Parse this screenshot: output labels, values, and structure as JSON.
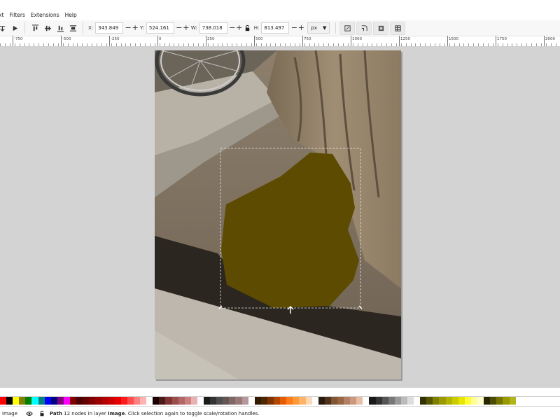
{
  "menubar": {
    "items": [
      "xt",
      "Filters",
      "Extensions",
      "Help"
    ]
  },
  "toolbar": {
    "x_label": "X:",
    "x_value": "343.849",
    "y_label": "Y:",
    "y_value": "524.161",
    "w_label": "W:",
    "w_value": "738.018",
    "h_label": "H:",
    "h_value": "813.497",
    "unit": "px",
    "minus": "−",
    "plus": "+"
  },
  "ruler": {
    "labels": [
      "-750",
      "-500",
      "-250",
      "0",
      "250",
      "500",
      "750",
      "1000",
      "1250",
      "1500",
      "1750",
      "2000"
    ]
  },
  "palette": {
    "colors": [
      "#ff0000",
      "#000000",
      "#ffff00",
      "#808000",
      "#008000",
      "#00ffff",
      "#008080",
      "#0000ff",
      "#000080",
      "#800080",
      "#ff00ff",
      "#800000",
      "#4d0000",
      "#660000",
      "#800000",
      "#990000",
      "#b30000",
      "#cc0000",
      "#e60000",
      "#ff1a1a",
      "#ff4d4d",
      "#ff8080",
      "#ffb3b3",
      "#ffffff",
      "#1a0000",
      "#4d1a1a",
      "#803333",
      "#994d4d",
      "#b36666",
      "#cc8080",
      "#e6b3b3",
      "#ffffff",
      "#1a1a1a",
      "#333333",
      "#4d4d4d",
      "#665555",
      "#806666",
      "#997777",
      "#b39999",
      "#ffffff",
      "#331a00",
      "#4d2600",
      "#803300",
      "#b34700",
      "#e65c00",
      "#ff7a1a",
      "#ff9933",
      "#ffb366",
      "#ffd9b3",
      "#ffffff",
      "#2b1a0d",
      "#4d3319",
      "#805533",
      "#996644",
      "#b38066",
      "#cc9980",
      "#e6bfa6",
      "#ffffff",
      "#1a1a1a",
      "#333333",
      "#555555",
      "#777777",
      "#999999",
      "#bbbbbb",
      "#dddddd",
      "#ffffff",
      "#333300",
      "#555500",
      "#808000",
      "#999900",
      "#b3b300",
      "#cccc00",
      "#e6e600",
      "#ffff33",
      "#ffff99",
      "#ffffcc",
      "#262600",
      "#4d4d00",
      "#737300",
      "#999900",
      "#b3b31a"
    ]
  },
  "status": {
    "layer_name": "Image",
    "object_type": "Path",
    "message": " 12 nodes in layer ",
    "layer_bold": "Image",
    "hint": ". Click selection again to toggle scale/rotation handles."
  }
}
